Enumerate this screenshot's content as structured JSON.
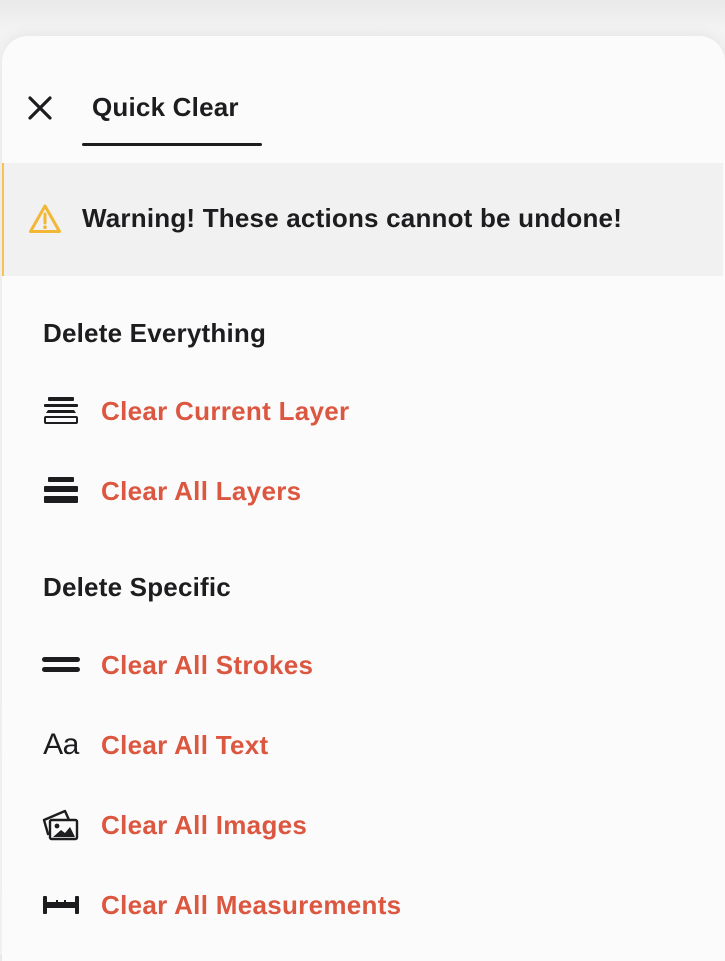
{
  "header": {
    "close_icon": "close-icon",
    "tab_label": "Quick Clear"
  },
  "warning": {
    "icon": "warning-triangle-icon",
    "text": "Warning! These actions cannot be undone!"
  },
  "sections": [
    {
      "title": "Delete Everything",
      "items": [
        {
          "icon": "current-layer-icon",
          "label": "Clear Current Layer"
        },
        {
          "icon": "all-layers-icon",
          "label": "Clear All Layers"
        }
      ]
    },
    {
      "title": "Delete Specific",
      "items": [
        {
          "icon": "strokes-icon",
          "label": "Clear All Strokes"
        },
        {
          "icon": "text-icon",
          "icon_text": "Aa",
          "label": "Clear All Text"
        },
        {
          "icon": "images-icon",
          "label": "Clear All Images"
        },
        {
          "icon": "measurement-icon",
          "label": "Clear All Measurements"
        }
      ]
    }
  ],
  "colors": {
    "accent_red": "#dc5740",
    "warning_border": "#f6c54f",
    "warning_icon": "#f2b735",
    "text_dark": "#1d1d1f",
    "warning_bg": "#f1f1f1",
    "panel_bg": "#fbfbfb"
  }
}
